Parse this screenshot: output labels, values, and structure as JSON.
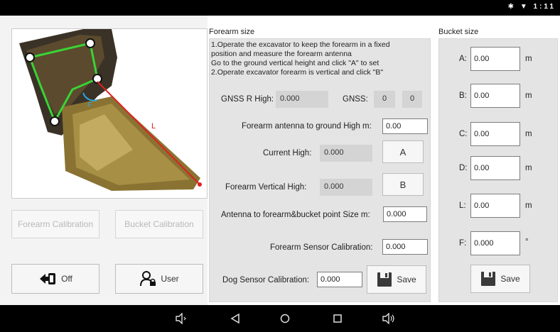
{
  "status_bar": {
    "icons": [
      "bluetooth-icon",
      "wifi-icon"
    ],
    "time": "1:11"
  },
  "left": {
    "photo": {
      "line_label": "L",
      "angle_label": "F"
    },
    "forearm_calibration_button": "Forearm Calibration",
    "bucket_calibration_button": "Bucket Calibration",
    "off_button": "Off",
    "user_button": "User"
  },
  "forearm": {
    "title": "Forearm size",
    "instructions": [
      "1.Operate the excavator to keep the forearm in a fixed",
      "position and measure the forearm antenna",
      "Go to the ground vertical height and click \"A\" to set",
      "2.Operate excavator forearm is vertical and click \"B\""
    ],
    "gnss_r_high_label": "GNSS R High:",
    "gnss_r_high_value": "0.000",
    "gnss_label": "GNSS:",
    "gnss_value_1": "0",
    "gnss_value_2": "0",
    "antenna_ground_label": "Forearm antenna to ground High m:",
    "antenna_ground_value": "0.00",
    "current_high_label": "Current High:",
    "current_high_value": "0.000",
    "button_a": "A",
    "vertical_high_label": "Forearm Vertical High:",
    "vertical_high_value": "0.000",
    "button_b": "B",
    "antenna_bucket_label": "Antenna to forearm&bucket point Size m:",
    "antenna_bucket_value": "0.000",
    "sensor_cal_label": "Forearm Sensor Calibration:",
    "sensor_cal_value": "0.000",
    "dog_sensor_label": "Dog Sensor Calibration:",
    "dog_sensor_value": "0.000",
    "save_button": "Save"
  },
  "bucket": {
    "title": "Bucket size",
    "fields": [
      {
        "label": "A:",
        "value": "0.00",
        "unit": "m"
      },
      {
        "label": "B:",
        "value": "0.00",
        "unit": "m"
      },
      {
        "label": "C:",
        "value": "0.00",
        "unit": "m"
      },
      {
        "label": "D:",
        "value": "0.00",
        "unit": "m"
      },
      {
        "label": "L:",
        "value": "0.00",
        "unit": "m"
      },
      {
        "label": "F:",
        "value": "0.000",
        "unit": "°"
      }
    ],
    "save_button": "Save"
  },
  "nav_bar": {
    "icons": [
      "volume-down-icon",
      "back-icon",
      "home-icon",
      "recents-icon",
      "volume-up-icon"
    ]
  }
}
